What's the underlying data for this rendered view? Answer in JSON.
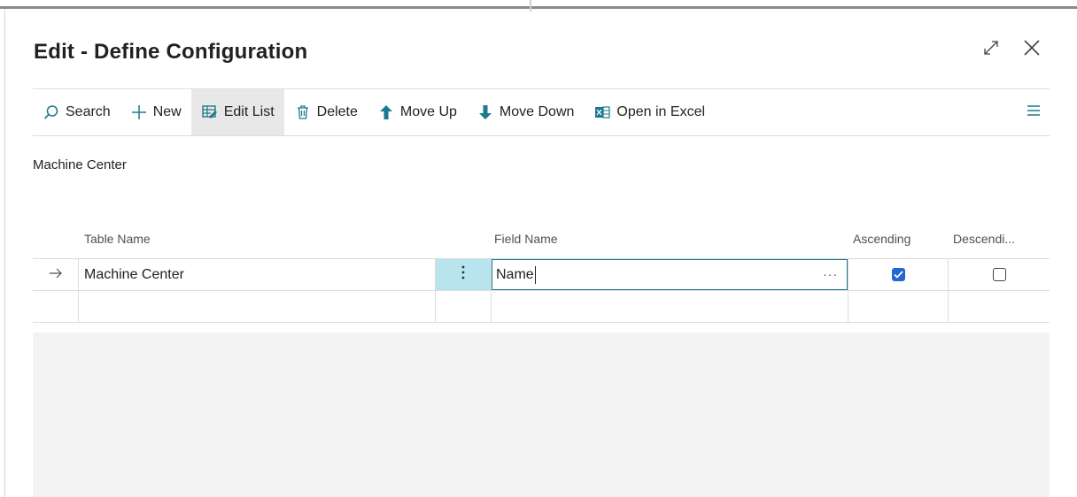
{
  "dialog": {
    "title": "Edit - Define Configuration"
  },
  "toolbar": {
    "items": [
      {
        "label": "Search",
        "icon": "search-icon"
      },
      {
        "label": "New",
        "icon": "plus-icon"
      },
      {
        "label": "Edit List",
        "icon": "edit-list-icon",
        "active": true
      },
      {
        "label": "Delete",
        "icon": "trash-icon"
      },
      {
        "label": "Move Up",
        "icon": "arrow-up-icon"
      },
      {
        "label": "Move Down",
        "icon": "arrow-down-icon"
      },
      {
        "label": "Open in Excel",
        "icon": "excel-icon"
      }
    ]
  },
  "subtitle": "Machine Center",
  "grid": {
    "columns": {
      "table_name": "Table Name",
      "field_name": "Field Name",
      "ascending": "Ascending",
      "descending": "Descendi..."
    },
    "rows": [
      {
        "table_name": "Machine Center",
        "field_name": "Name",
        "ascending": true,
        "descending": false
      },
      {
        "table_name": "",
        "field_name": "",
        "ascending": null,
        "descending": null
      }
    ]
  },
  "colors": {
    "accent": "#1d7a8c",
    "checkbox": "#2168d4",
    "row_highlight": "#b7e4ed"
  }
}
